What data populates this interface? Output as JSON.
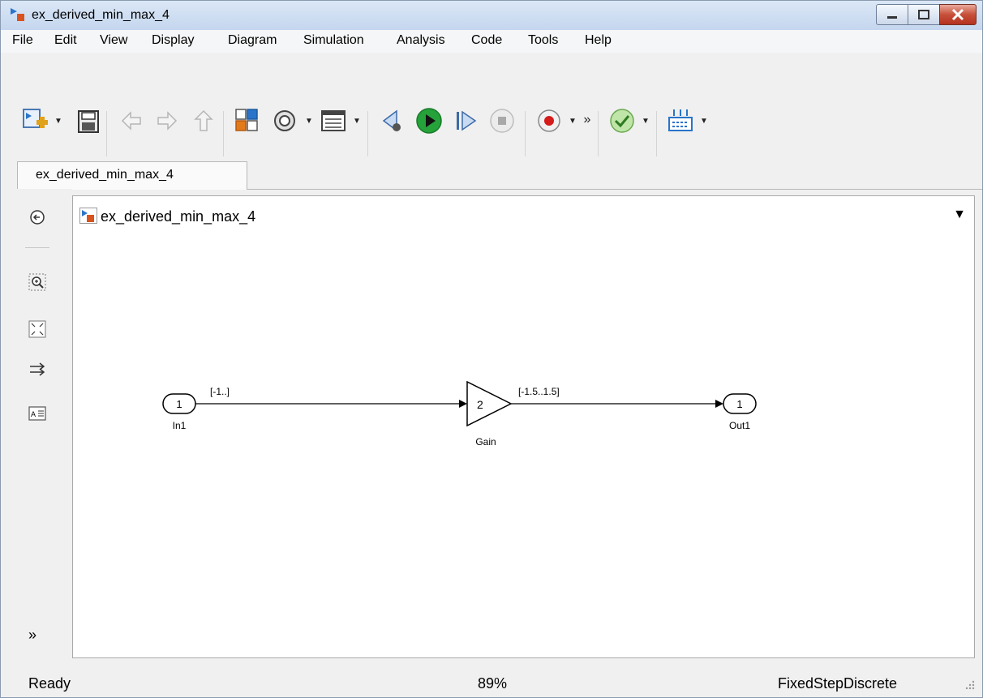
{
  "window": {
    "title": "ex_derived_min_max_4",
    "controls": [
      "minimize",
      "maximize",
      "close"
    ]
  },
  "menu": {
    "items": [
      "File",
      "Edit",
      "View",
      "Display",
      "Diagram",
      "Simulation",
      "Analysis",
      "Code",
      "Tools",
      "Help"
    ]
  },
  "toolbar": {
    "overflow_label": "»",
    "buttons": [
      "new-model-icon",
      "save-icon",
      "back-icon",
      "forward-icon",
      "up-icon",
      "library-browser-icon",
      "model-config-icon",
      "model-explorer-icon",
      "step-back-icon",
      "run-icon",
      "step-forward-icon",
      "stop-icon",
      "record-icon",
      "check-icon",
      "model-advisor-icon"
    ]
  },
  "tab": {
    "label": "ex_derived_min_max_4"
  },
  "address": {
    "path": "ex_derived_min_max_4"
  },
  "palette": {
    "expand_label": "»"
  },
  "diagram": {
    "inport": {
      "number": "1",
      "name": "In1",
      "signal_range": "[-1..]"
    },
    "gain": {
      "value": "2",
      "name": "Gain",
      "signal_range": "[-1.5..1.5]"
    },
    "outport": {
      "number": "1",
      "name": "Out1"
    }
  },
  "status": {
    "state": "Ready",
    "zoom": "89%",
    "solver": "FixedStepDiscrete"
  },
  "colors": {
    "accent_blue": "#2a74c9",
    "run_green": "#25a23a",
    "record_red": "#d61b1b"
  }
}
